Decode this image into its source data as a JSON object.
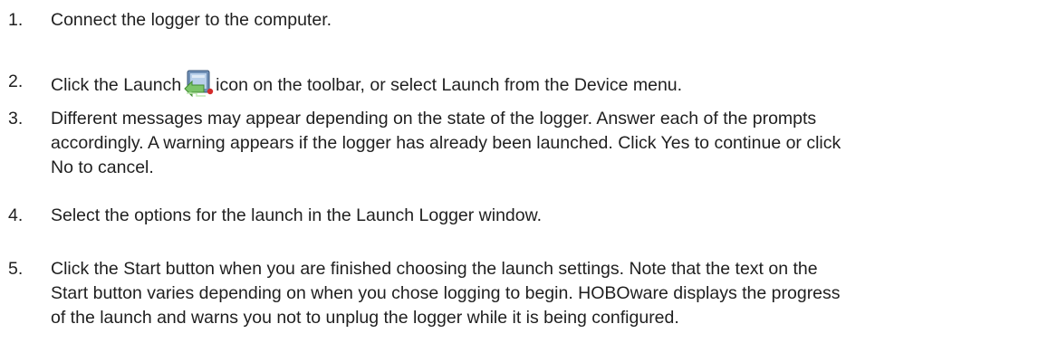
{
  "steps": [
    {
      "number": "1.",
      "text": "Connect the logger to the computer."
    },
    {
      "number": "2.",
      "text_before_icon": "Click the Launch",
      "icon": "launch-logger-icon",
      "text_after_icon": "icon on the toolbar, or select Launch from the Device menu."
    },
    {
      "number": "3.",
      "lines": [
        "Different messages may appear depending on the state of the logger. Answer each of the prompts",
        "accordingly. A warning appears if the logger has already been launched. Click Yes to continue or click",
        "No to cancel."
      ]
    },
    {
      "number": "4.",
      "text": "Select the options for the launch in the Launch Logger window."
    },
    {
      "number": "5.",
      "lines": [
        "Click the Start button when you are finished choosing the launch settings. Note that the text on the",
        "Start button varies depending on when you chose logging to begin. HOBOware displays the progress",
        "of the launch and warns you not to unplug the logger while it is being configured."
      ]
    }
  ]
}
